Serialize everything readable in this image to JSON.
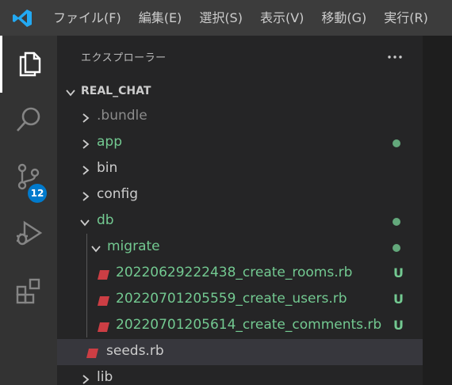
{
  "menu": {
    "items": [
      {
        "label": "ファイル(F)"
      },
      {
        "label": "編集(E)"
      },
      {
        "label": "選択(S)"
      },
      {
        "label": "表示(V)"
      },
      {
        "label": "移動(G)"
      },
      {
        "label": "実行(R)"
      }
    ]
  },
  "activity": {
    "items": [
      {
        "icon": "files-icon"
      },
      {
        "icon": "search-icon"
      },
      {
        "icon": "source-control-icon",
        "badge": "12"
      },
      {
        "icon": "run-debug-icon"
      },
      {
        "icon": "extensions-icon"
      }
    ]
  },
  "explorer": {
    "title": "エクスプローラー",
    "more": "···",
    "folder": "REAL_CHAT",
    "rows": [
      {
        "label": ".bundle"
      },
      {
        "label": "app"
      },
      {
        "label": "bin"
      },
      {
        "label": "config"
      },
      {
        "label": "db"
      },
      {
        "label": "migrate"
      },
      {
        "label": "20220629222438_create_rooms.rb",
        "status": "U"
      },
      {
        "label": "20220701205559_create_users.rb",
        "status": "U"
      },
      {
        "label": "20220701205614_create_comments.rb",
        "status": "U"
      },
      {
        "label": "seeds.rb"
      },
      {
        "label": "lib"
      }
    ]
  },
  "colors": {
    "untracked": "#73c991",
    "ignored": "#8c8c8c",
    "ruby": "#cc3e44",
    "badge": "#007acc"
  }
}
